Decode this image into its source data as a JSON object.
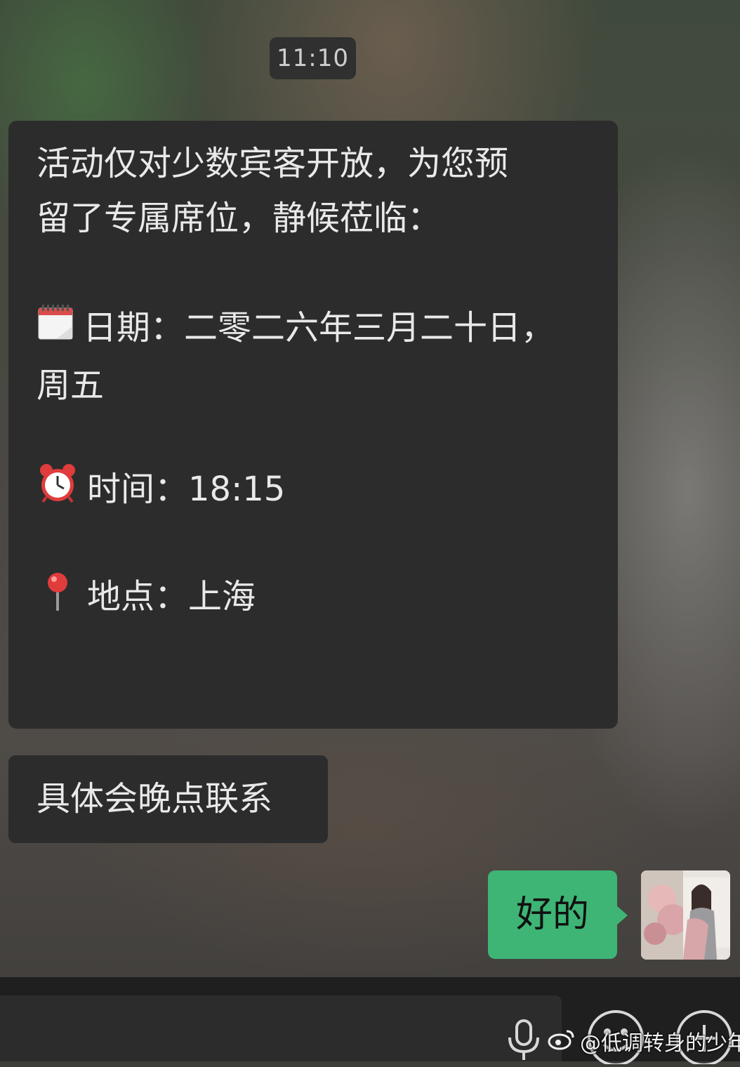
{
  "chat": {
    "timestamp": "11:10",
    "messages": [
      {
        "direction": "incoming",
        "lines": [
          "活动仅对少数宾客开放，为您预",
          "留了专属席位，静候莅临：",
          "日期：二零二六年三月二十日，",
          "周五",
          "时间：18:15",
          "地点：上海"
        ],
        "icons": [
          "calendar-icon",
          "alarm-clock-icon",
          "map-pin-icon"
        ]
      },
      {
        "direction": "incoming",
        "text": "具体会晚点联系"
      },
      {
        "direction": "outgoing",
        "text": "好的"
      }
    ]
  },
  "input_bar": {
    "icons": [
      "microphone-icon",
      "emoji-icon",
      "more-plus-icon"
    ]
  },
  "watermark": {
    "text": "@低调转身的少年"
  },
  "colors": {
    "incoming_bubble": "#2c2c2c",
    "outgoing_bubble": "#3eb575",
    "bottom_bar": "#1f1f1f"
  }
}
